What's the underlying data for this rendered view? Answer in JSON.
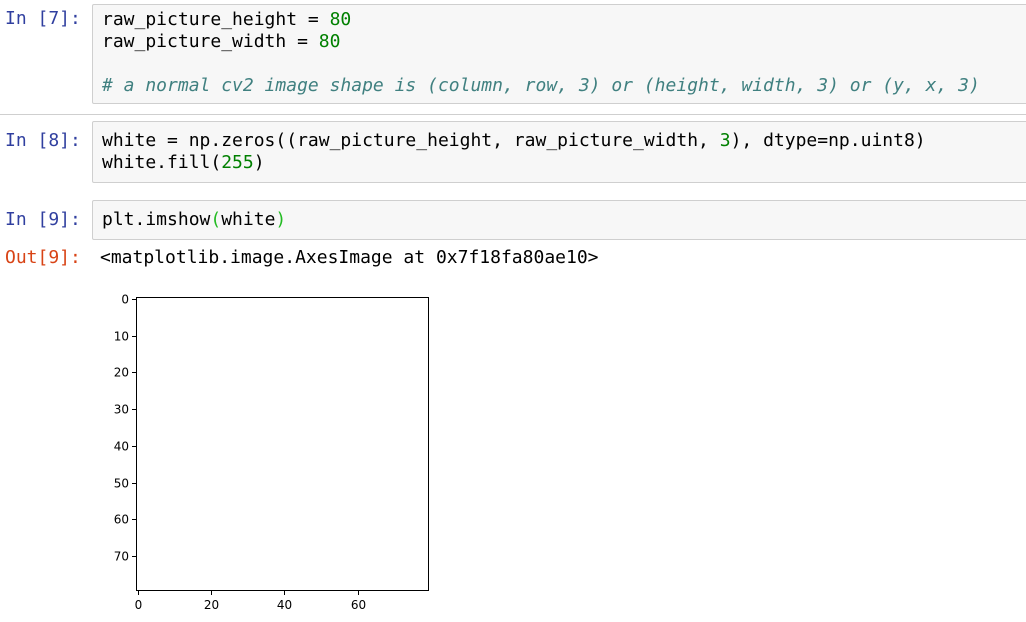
{
  "cells": [
    {
      "prompt": "In [7]:",
      "lines": [
        [
          "raw_picture_height = ",
          "80"
        ],
        [
          "raw_picture_width = ",
          "80"
        ],
        [
          "# a normal cv2 image shape is (column, row, 3) or (height, width, 3) or (y, x, 3)"
        ]
      ]
    },
    {
      "prompt": "In [8]:",
      "lines": [
        [
          "white = np.zeros((raw_picture_height, raw_picture_width, ",
          "3",
          "), dtype=np.uint8)"
        ],
        [
          "white.fill(",
          "255",
          ")"
        ]
      ]
    },
    {
      "prompt": "In [9]:",
      "lines": [
        [
          "plt.imshow",
          "(",
          "white",
          ")"
        ]
      ]
    }
  ],
  "output": {
    "prompt": "Out[9]:",
    "repr_text": "<matplotlib.image.AxesImage at 0x7f18fa80ae10>"
  },
  "chart_data": {
    "type": "heatmap",
    "title": "",
    "xlabel": "",
    "ylabel": "",
    "image_fill": "#ffffff",
    "xlim": [
      -0.5,
      79.5
    ],
    "ylim": [
      79.5,
      -0.5
    ],
    "x_ticks": [
      0,
      20,
      40,
      60
    ],
    "y_ticks": [
      0,
      10,
      20,
      30,
      40,
      50,
      60,
      70
    ],
    "grid": false
  }
}
